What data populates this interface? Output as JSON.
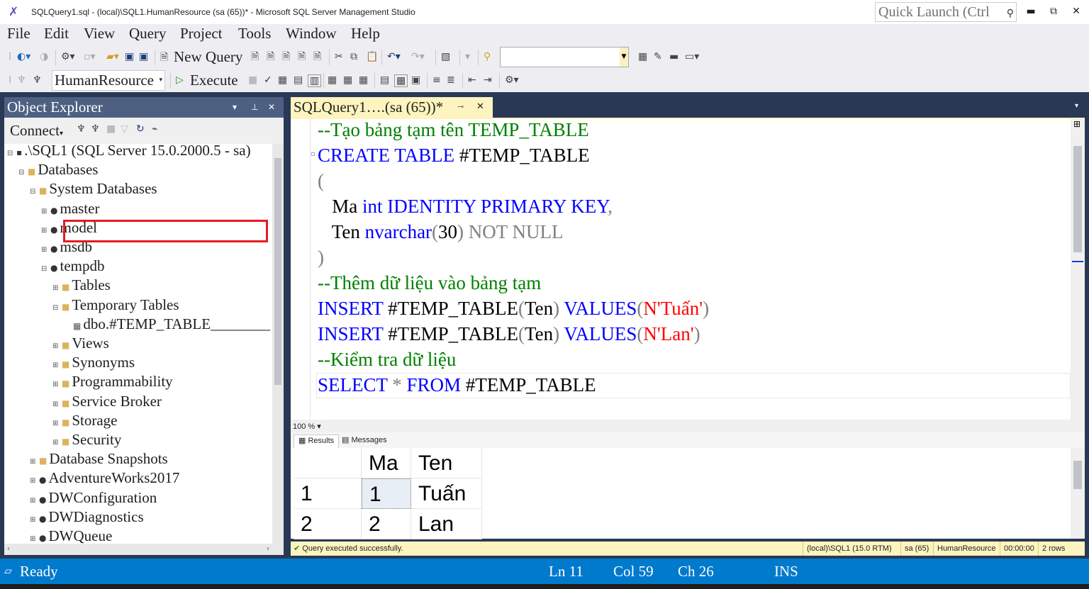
{
  "window": {
    "title": "SQLQuery1.sql - (local)\\SQL1.HumanResource (sa (65))* - Microsoft SQL Server Management Studio",
    "quick_launch_placeholder": "Quick Launch (Ctrl"
  },
  "menu": [
    "File",
    "Edit",
    "View",
    "Query",
    "Project",
    "Tools",
    "Window",
    "Help"
  ],
  "toolbar": {
    "new_query": "New Query",
    "database": "HumanResource",
    "execute": "Execute"
  },
  "object_explorer": {
    "title": "Object Explorer",
    "connect": "Connect",
    "tree": [
      {
        "label": ".\\SQL1 (SQL Server 15.0.2000.5 - sa)",
        "exp": "⊟",
        "icon": "server"
      },
      {
        "label": "Databases",
        "exp": "⊟",
        "icon": "folder"
      },
      {
        "label": "System Databases",
        "exp": "⊟",
        "icon": "folder"
      },
      {
        "label": "master",
        "exp": "⊞",
        "icon": "db"
      },
      {
        "label": "model",
        "exp": "⊞",
        "icon": "db"
      },
      {
        "label": "msdb",
        "exp": "⊞",
        "icon": "db"
      },
      {
        "label": "tempdb",
        "exp": "⊟",
        "icon": "db"
      },
      {
        "label": "Tables",
        "exp": "⊞",
        "icon": "folder"
      },
      {
        "label": "Temporary Tables",
        "exp": "⊟",
        "icon": "folder"
      },
      {
        "label": "dbo.#TEMP_TABLE________",
        "exp": "",
        "icon": "table"
      },
      {
        "label": "Views",
        "exp": "⊞",
        "icon": "folder"
      },
      {
        "label": "Synonyms",
        "exp": "⊞",
        "icon": "folder"
      },
      {
        "label": "Programmability",
        "exp": "⊞",
        "icon": "folder"
      },
      {
        "label": "Service Broker",
        "exp": "⊞",
        "icon": "folder"
      },
      {
        "label": "Storage",
        "exp": "⊞",
        "icon": "folder"
      },
      {
        "label": "Security",
        "exp": "⊞",
        "icon": "folder"
      },
      {
        "label": "Database Snapshots",
        "exp": "⊞",
        "icon": "folder"
      },
      {
        "label": "AdventureWorks2017",
        "exp": "⊞",
        "icon": "db"
      },
      {
        "label": "DWConfiguration",
        "exp": "⊞",
        "icon": "db"
      },
      {
        "label": "DWDiagnostics",
        "exp": "⊞",
        "icon": "db"
      },
      {
        "label": "DWQueue",
        "exp": "⊞",
        "icon": "db"
      }
    ]
  },
  "doc_tab": {
    "label": "SQLQuery1….(sa (65))*"
  },
  "editor": {
    "lines": [
      [
        {
          "t": "--Tạo bảng tạm tên TEMP_TABLE",
          "c": "cm"
        }
      ],
      [
        {
          "t": "CREATE TABLE",
          "c": "kw"
        },
        {
          "t": " #TEMP_TABLE",
          "c": "tx"
        }
      ],
      [
        {
          "t": "(",
          "c": "gr"
        }
      ],
      [
        {
          "t": "   Ma ",
          "c": "tx"
        },
        {
          "t": "int IDENTITY PRIMARY KEY",
          "c": "kw"
        },
        {
          "t": ",",
          "c": "gr"
        }
      ],
      [
        {
          "t": "   Ten ",
          "c": "tx"
        },
        {
          "t": "nvarchar",
          "c": "kw"
        },
        {
          "t": "(",
          "c": "gr"
        },
        {
          "t": "30",
          "c": "tx"
        },
        {
          "t": ") NOT NULL",
          "c": "gr"
        }
      ],
      [
        {
          "t": ")",
          "c": "gr"
        }
      ],
      [
        {
          "t": "--Thêm dữ liệu vào bảng tạm",
          "c": "cm"
        }
      ],
      [
        {
          "t": "INSERT",
          "c": "kw"
        },
        {
          "t": " #TEMP_TABLE",
          "c": "tx"
        },
        {
          "t": "(",
          "c": "gr"
        },
        {
          "t": "Ten",
          "c": "tx"
        },
        {
          "t": ") ",
          "c": "gr"
        },
        {
          "t": "VALUES",
          "c": "kw"
        },
        {
          "t": "(",
          "c": "gr"
        },
        {
          "t": "N'Tuấn'",
          "c": "st"
        },
        {
          "t": ")",
          "c": "gr"
        }
      ],
      [
        {
          "t": "INSERT",
          "c": "kw"
        },
        {
          "t": " #TEMP_TABLE",
          "c": "tx"
        },
        {
          "t": "(",
          "c": "gr"
        },
        {
          "t": "Ten",
          "c": "tx"
        },
        {
          "t": ") ",
          "c": "gr"
        },
        {
          "t": "VALUES",
          "c": "kw"
        },
        {
          "t": "(",
          "c": "gr"
        },
        {
          "t": "N'Lan'",
          "c": "st"
        },
        {
          "t": ")",
          "c": "gr"
        }
      ],
      [
        {
          "t": "--Kiểm tra dữ liệu",
          "c": "cm"
        }
      ],
      [
        {
          "t": "SELECT",
          "c": "kw"
        },
        {
          "t": " * ",
          "c": "gr"
        },
        {
          "t": "FROM",
          "c": "kw"
        },
        {
          "t": " #TEMP_TABLE",
          "c": "tx"
        }
      ]
    ],
    "zoom": "100 %"
  },
  "results": {
    "tabs": [
      "Results",
      "Messages"
    ],
    "columns": [
      "Ma",
      "Ten"
    ],
    "rows": [
      {
        "num": "1",
        "Ma": "1",
        "Ten": "Tuấn"
      },
      {
        "num": "2",
        "Ma": "2",
        "Ten": "Lan"
      }
    ]
  },
  "query_status": {
    "message": "Query executed successfully.",
    "server": "(local)\\SQL1 (15.0 RTM)",
    "user": "sa (65)",
    "database": "HumanResource",
    "elapsed": "00:00:00",
    "rows": "2 rows"
  },
  "status_bar": {
    "state": "Ready",
    "ln": "Ln 11",
    "col": "Col 59",
    "ch": "Ch 26",
    "mode": "INS"
  },
  "colors": {
    "accent": "#007acc",
    "panel_header": "#4d6082",
    "highlight_box": "#e51c23",
    "keyword": "#0000ff",
    "comment": "#008000",
    "string": "#ff0000"
  }
}
